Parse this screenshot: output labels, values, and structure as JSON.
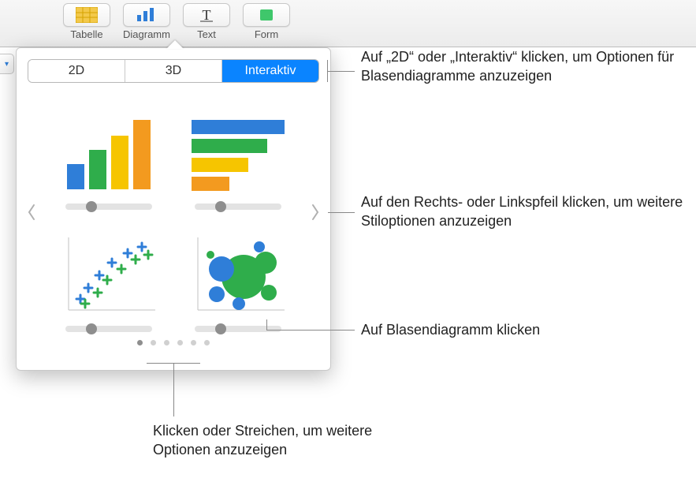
{
  "toolbar": {
    "items": [
      {
        "label": "Tabelle"
      },
      {
        "label": "Diagramm"
      },
      {
        "label": "Text"
      },
      {
        "label": "Form"
      }
    ]
  },
  "popover": {
    "tabs": {
      "tab_2d": "2D",
      "tab_3d": "3D",
      "tab_interactive": "Interaktiv",
      "selected": "Interaktiv"
    },
    "thumbnails": [
      {
        "name": "bar-chart-thumb"
      },
      {
        "name": "horizontal-bar-chart-thumb"
      },
      {
        "name": "scatter-plot-thumb"
      },
      {
        "name": "bubble-chart-thumb"
      }
    ],
    "page_count": 6,
    "active_page": 0
  },
  "callouts": {
    "tabs_hint": "Auf „2D“ oder „Interaktiv“ klicken, um Optionen für Blasendiagramme anzuzeigen",
    "arrows_hint": "Auf den Rechts- oder Linkspfeil klicken, um weitere Stiloptionen anzuzeigen",
    "bubble_hint": "Auf Blasendiagramm klicken",
    "dots_hint": "Klicken oder Streichen, um weitere Optionen anzuzeigen"
  },
  "colors": {
    "accent": "#0a84ff",
    "bar_blue": "#2f7ed8",
    "bar_green": "#2fad4b",
    "bar_yellow": "#f6c500",
    "bar_orange": "#f39a1f"
  }
}
